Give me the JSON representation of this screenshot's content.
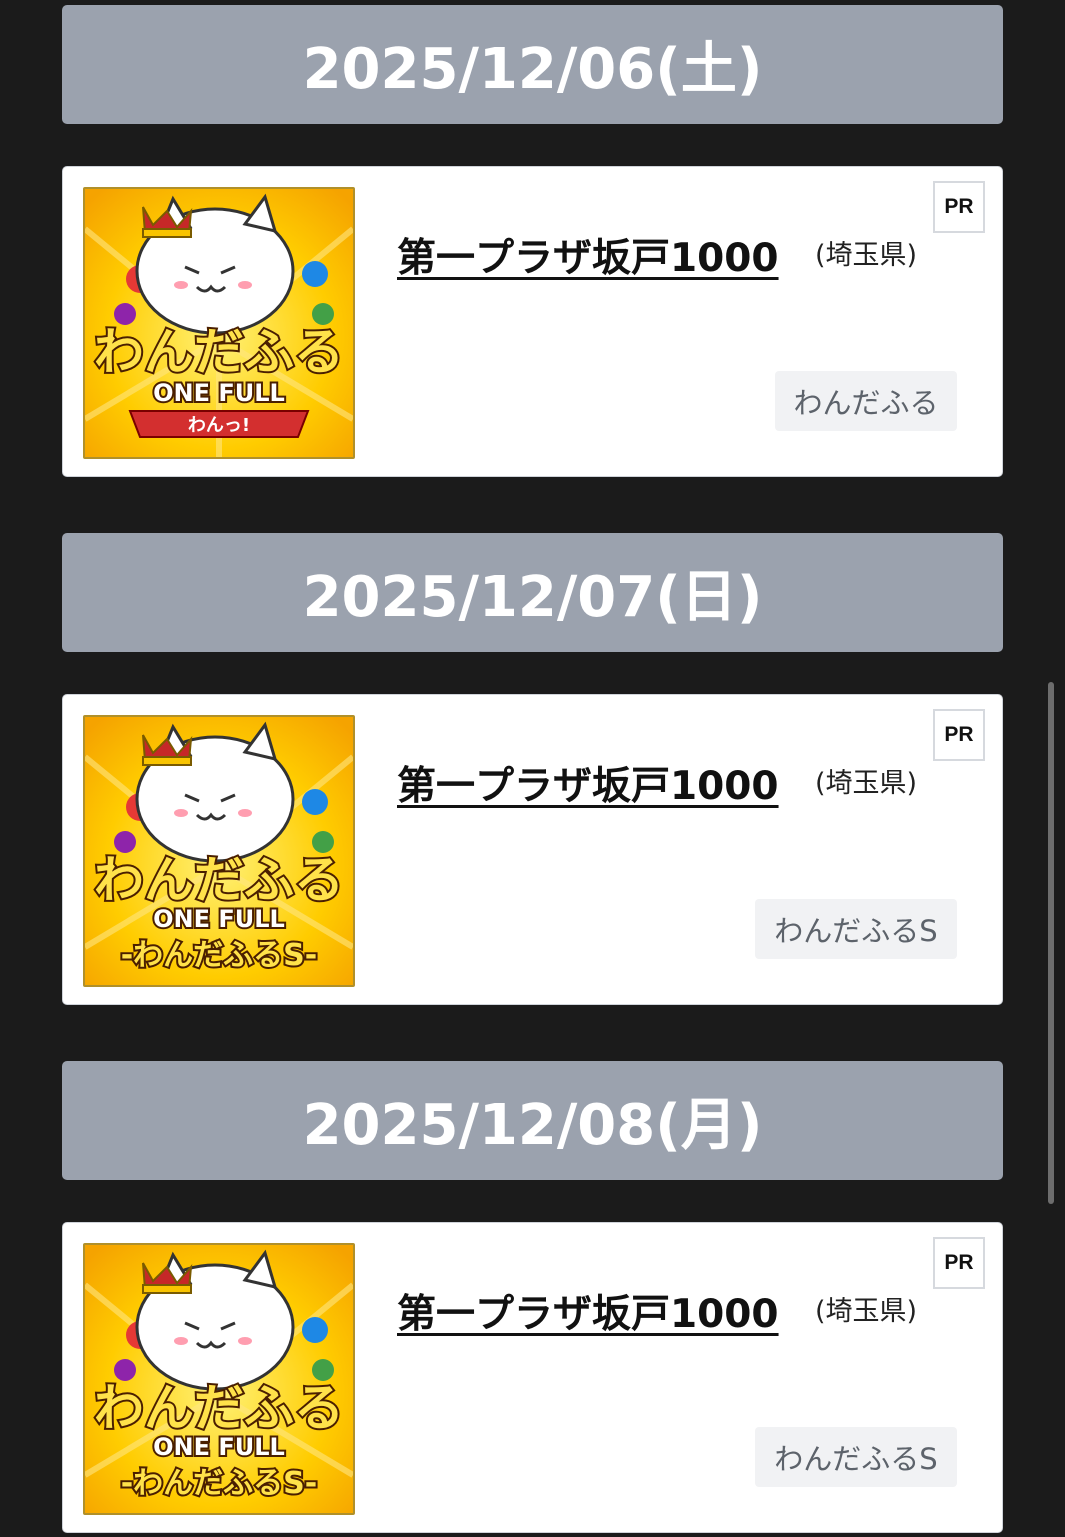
{
  "days": [
    {
      "date": "2025/12/06(土)",
      "entry": {
        "store": "第一プラザ坂戸1000",
        "prefecture": "(埼玉県)",
        "badge": "PR",
        "machine_tag": "わんだふる",
        "thumb_title": "わんだふる",
        "thumb_logo": "ONE FULL",
        "thumb_ribbon": "わんっ!"
      }
    },
    {
      "date": "2025/12/07(日)",
      "entry": {
        "store": "第一プラザ坂戸1000",
        "prefecture": "(埼玉県)",
        "badge": "PR",
        "machine_tag": "わんだふるS",
        "thumb_title": "わんだふる",
        "thumb_logo": "ONE FULL",
        "thumb_ribbon": "-わんだふるS-"
      }
    },
    {
      "date": "2025/12/08(月)",
      "entry": {
        "store": "第一プラザ坂戸1000",
        "prefecture": "(埼玉県)",
        "badge": "PR",
        "machine_tag": "わんだふるS",
        "thumb_title": "わんだふる",
        "thumb_logo": "ONE FULL",
        "thumb_ribbon": "-わんだふるS-"
      }
    }
  ],
  "colors": {
    "background": "#1b1b1b",
    "date_header": "#9ba2ae",
    "tag_bg": "#f1f2f4",
    "thumb_yellow": "#ffcc00"
  }
}
